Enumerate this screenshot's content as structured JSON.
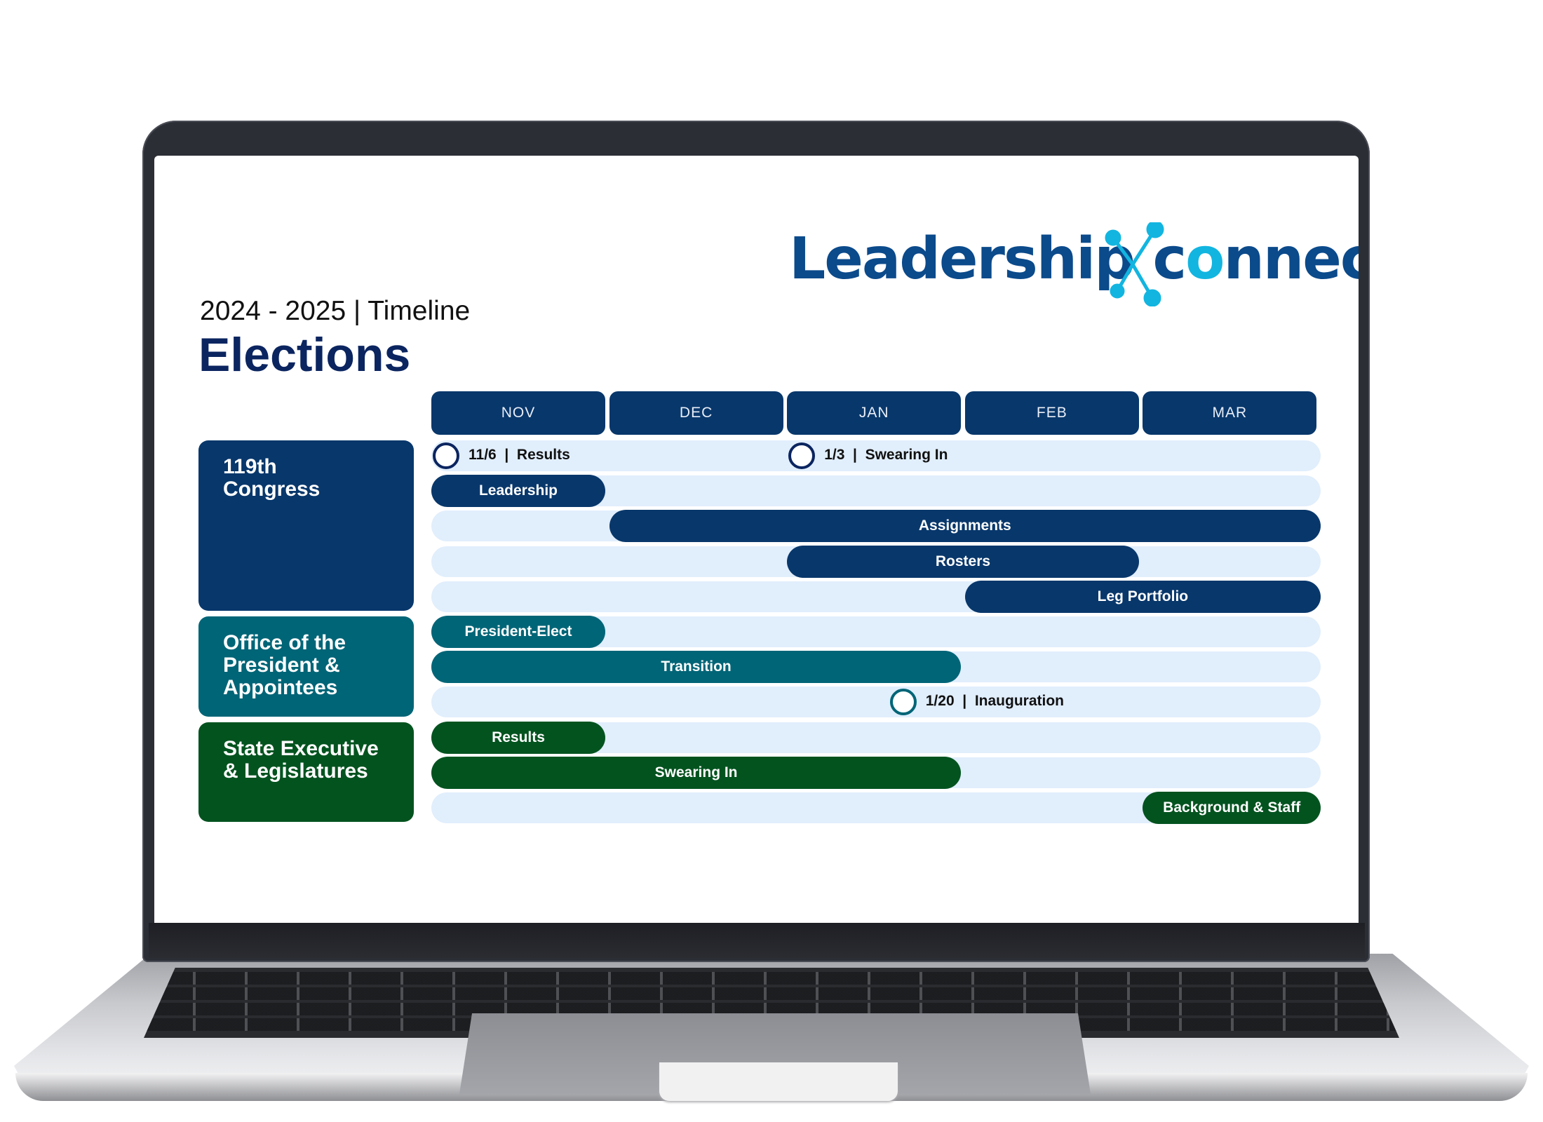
{
  "brand": {
    "name_part1": "Leadership c",
    "name_o": "o",
    "name_part2": "nnect",
    "primary_color": "#0b4a8b",
    "accent_color": "#12b5e0"
  },
  "header": {
    "subtitle": "2024 - 2025  |  Timeline",
    "title": "Elections"
  },
  "months": [
    "NOV",
    "DEC",
    "JAN",
    "FEB",
    "MAR"
  ],
  "colors": {
    "congress": "#08376b",
    "president": "#006577",
    "state": "#03531f",
    "track": "#e1eefc"
  },
  "groups": [
    {
      "label": "119th\nCongress",
      "color_key": "congress",
      "rows": [
        {
          "type": "milestones",
          "items": [
            {
              "label": "11/6  |  Results",
              "at": 0.0
            },
            {
              "label": "1/3  |  Swearing In",
              "at": 2.0
            }
          ]
        },
        {
          "type": "bar",
          "label": "Leadership",
          "start": 0,
          "end": 1
        },
        {
          "type": "bar",
          "label": "Assignments",
          "start": 1,
          "end": 5
        },
        {
          "type": "bar",
          "label": "Rosters",
          "start": 2,
          "end": 4
        },
        {
          "type": "bar",
          "label": "Leg Portfolio",
          "start": 3,
          "end": 5
        }
      ]
    },
    {
      "label": "Office of the\nPresident &\nAppointees",
      "color_key": "president",
      "rows": [
        {
          "type": "bar",
          "label": "President-Elect",
          "start": 0,
          "end": 1
        },
        {
          "type": "bar",
          "label": "Transition",
          "start": 0,
          "end": 3
        },
        {
          "type": "milestones",
          "items": [
            {
              "label": "1/20  |  Inauguration",
              "at": 2.57
            }
          ]
        }
      ]
    },
    {
      "label": "State Executive\n& Legislatures",
      "color_key": "state",
      "rows": [
        {
          "type": "bar",
          "label": "Results",
          "start": 0,
          "end": 1
        },
        {
          "type": "bar",
          "label": "Swearing In",
          "start": 0,
          "end": 3
        },
        {
          "type": "bar",
          "label": "Background & Staff",
          "start": 4,
          "end": 5
        }
      ]
    }
  ]
}
